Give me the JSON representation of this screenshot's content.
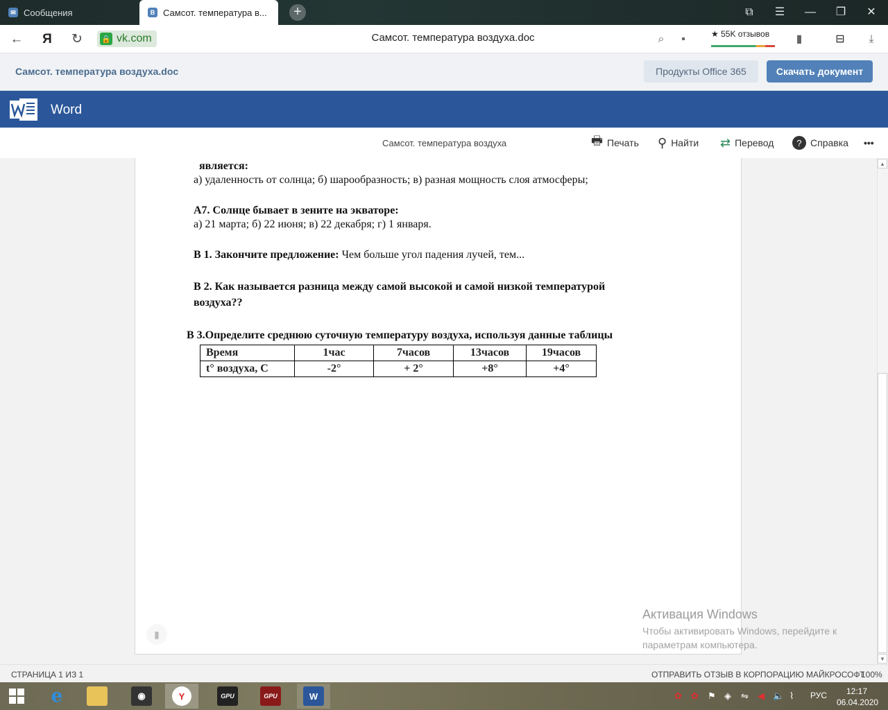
{
  "browser": {
    "tabs": [
      {
        "label": "Сообщения",
        "icon": "vk-messages-icon"
      },
      {
        "label": "Самсот. температура в...",
        "icon": "vk-icon"
      }
    ],
    "new_tab": "+",
    "window_controls": {
      "min": "—",
      "restore": "❐",
      "close": "✕"
    },
    "url": "vk.com",
    "page_title": "Самсот. температура воздуха.doc",
    "reviews": "★ 55K отзывов"
  },
  "vk": {
    "doc_title": "Самсот. температура воздуха.doc",
    "office_button": "Продукты Office 365",
    "download_button": "Скачать документ"
  },
  "word": {
    "app_name": "Word",
    "doc_label": "Самсот. температура воздуха",
    "toolbar": {
      "print": "Печать",
      "find": "Найти",
      "translate": "Перевод",
      "help": "Справка",
      "more": "•••"
    }
  },
  "document": {
    "line_is": "является:",
    "line_a6": "а) удаленность от солнца;   б) шарообразность;  в) разная мощность слоя атмосферы;",
    "a7_title": "А7.  Солнце бывает в зените на экваторе:",
    "a7_options": "а) 21 марта;  б) 22 июня;   в) 22 декабря;   г) 1 января.",
    "b1_title": "В 1. Закончите предложение:",
    "b1_text": " Чем больше угол падения лучей, тем...",
    "b2_line1": "В 2. Как называется разница между самой высокой и самой низкой  температурой",
    "b2_line2": "воздуха??",
    "b3_title": "В 3.Определите среднюю суточную температуру воздуха, используя данные таблицы",
    "table": {
      "header": [
        "Время",
        "1час",
        "7часов",
        "13часов",
        "19часов"
      ],
      "row": [
        "t° воздуха, С",
        "-2°",
        "+ 2°",
        "+8°",
        "+4°"
      ]
    }
  },
  "watermark": {
    "title": "Активация Windows",
    "text": "Чтобы активировать Windows, перейдите к параметрам компьютера."
  },
  "status": {
    "page": "СТРАНИЦА 1 ИЗ 1",
    "feedback": "ОТПРАВИТЬ ОТЗЫВ В КОРПОРАЦИЮ МАЙКРОСОФТ",
    "zoom": "100%"
  },
  "taskbar": {
    "lang": "РУС",
    "time": "12:17",
    "date": "06.04.2020"
  }
}
